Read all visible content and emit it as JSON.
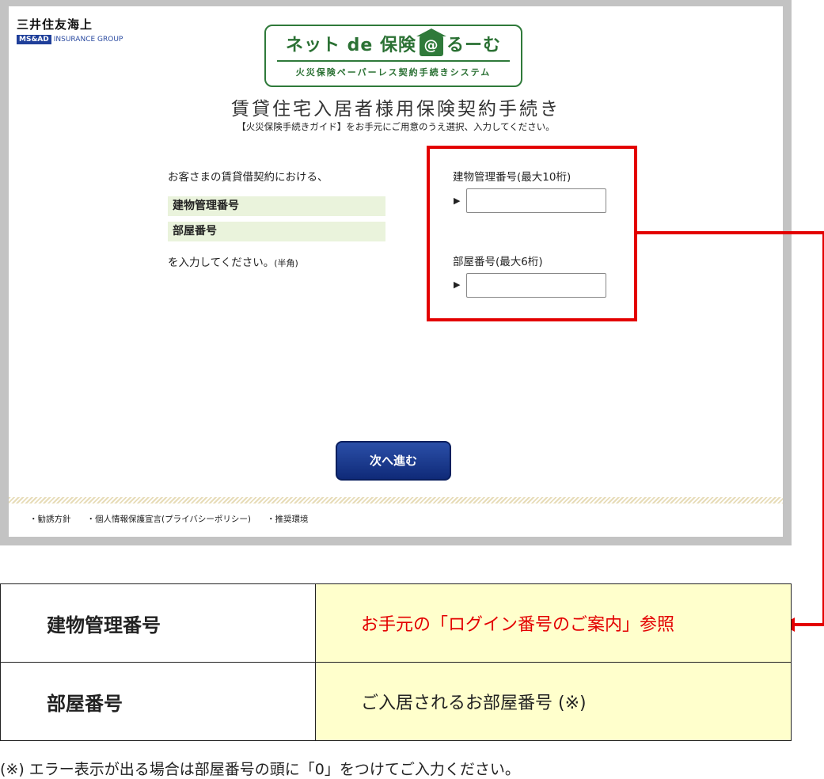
{
  "brand": {
    "name": "三井住友海上",
    "badge": "MS&AD",
    "group": "INSURANCE GROUP"
  },
  "logo": {
    "main_left": "ネット de 保険",
    "house": "@",
    "main_right": "るーむ",
    "sub": "火災保険ペーパーレス契約手続きシステム"
  },
  "page": {
    "title": "賃貸住宅入居者様用保険契約手続き",
    "subtitle": "【火災保険手続きガイド】をお手元にご用意のうえ選択、入力してください。"
  },
  "intro": {
    "lead": "お客さまの賃貸借契約における、",
    "item1": "建物管理番号",
    "item2": "部屋番号",
    "instruction": "を入力してください。",
    "instruction_note": "(半角)"
  },
  "form": {
    "building_label": "建物管理番号(最大10桁)",
    "building_value": "",
    "room_label": "部屋番号(最大6桁)",
    "room_value": "",
    "arrow": "▶",
    "next_button": "次へ進む"
  },
  "footer": {
    "links": [
      "・勧誘方針",
      "・個人情報保護宣言(プライバシーポリシー)",
      "・推奨環境"
    ]
  },
  "table": {
    "row1_label": "建物管理番号",
    "row1_value": "お手元の「ログイン番号のご案内」参照",
    "row2_label": "部屋番号",
    "row2_value": "ご入居されるお部屋番号 (※)"
  },
  "note": "(※) エラー表示が出る場合は部屋番号の頭に「0」をつけてご入力ください。",
  "colors": {
    "accent_red": "#e30000",
    "brand_green": "#2f7a3a",
    "button_blue": "#1f3f9a",
    "highlight_green": "#eaf3dc",
    "table_yellow": "#ffffcc"
  }
}
